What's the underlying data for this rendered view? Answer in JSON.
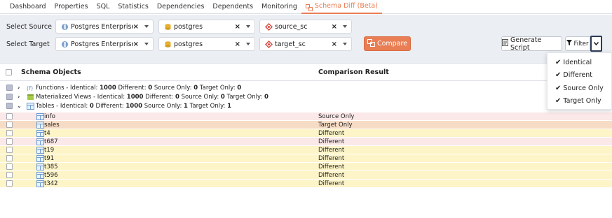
{
  "tabs": [
    {
      "label": "Dashboard"
    },
    {
      "label": "Properties"
    },
    {
      "label": "SQL"
    },
    {
      "label": "Statistics"
    },
    {
      "label": "Dependencies"
    },
    {
      "label": "Dependents"
    },
    {
      "label": "Monitoring"
    },
    {
      "label": "Schema Diff (Beta)",
      "active": true
    }
  ],
  "source": {
    "label": "Select Source",
    "server": "Postgres Enterprise ...",
    "database": "postgres",
    "schema": "source_sc"
  },
  "target": {
    "label": "Select Target",
    "server": "Postgres Enterprise ...",
    "database": "postgres",
    "schema": "target_sc"
  },
  "buttons": {
    "compare": "Compare",
    "generate_script": "Generate Script",
    "filter": "Filter"
  },
  "table": {
    "col_schema": "Schema Objects",
    "col_result": "Comparison Result"
  },
  "groups": [
    {
      "name": "Functions",
      "prefix": "Functions - Identical: ",
      "identical": "1000",
      "different_label": " Different: ",
      "different": "0",
      "source_label": " Source Only: ",
      "source_only": "0",
      "target_label": " Target Only: ",
      "target_only": "0",
      "expanded": false
    },
    {
      "name": "Materialized Views",
      "prefix": "Materialized Views - Identical: ",
      "identical": "1000",
      "different_label": " Different: ",
      "different": "0",
      "source_label": " Source Only: ",
      "source_only": "0",
      "target_label": " Target Only: ",
      "target_only": "0",
      "expanded": false
    },
    {
      "name": "Tables",
      "prefix": "Tables - Identical: ",
      "identical": "0",
      "different_label": " Different: ",
      "different": "1000",
      "source_label": " Source Only: ",
      "source_only": "1",
      "target_label": " Target Only: ",
      "target_only": "1",
      "expanded": true
    }
  ],
  "rows": [
    {
      "name": "info",
      "result": "Source Only",
      "status": "source"
    },
    {
      "name": "sales",
      "result": "Target Only",
      "status": "target"
    },
    {
      "name": "t4",
      "result": "Different",
      "status": "diff"
    },
    {
      "name": "t687",
      "result": "Different",
      "status": "diff-pink"
    },
    {
      "name": "t19",
      "result": "Different",
      "status": "diff"
    },
    {
      "name": "t91",
      "result": "Different",
      "status": "diff"
    },
    {
      "name": "t385",
      "result": "Different",
      "status": "diff"
    },
    {
      "name": "t596",
      "result": "Different",
      "status": "diff"
    },
    {
      "name": "t342",
      "result": "Different",
      "status": "diff"
    }
  ],
  "filter_menu": [
    {
      "label": "Identical",
      "checked": true
    },
    {
      "label": "Different",
      "checked": true
    },
    {
      "label": "Source Only",
      "checked": true
    },
    {
      "label": "Target Only",
      "checked": true
    }
  ],
  "colors": {
    "accent": "#e97e55",
    "source_only_bg": "#fbe8e8",
    "target_only_bg": "#f7dcc5",
    "different_bg": "#fdf4c8"
  },
  "icons": {
    "server": "server-icon",
    "database": "database-icon",
    "schema": "schema-icon",
    "compare": "compare-icon",
    "generate": "script-icon",
    "filter": "filter-icon",
    "table": "table-icon",
    "function": "function-icon",
    "matview": "materialized-view-icon",
    "check": "checkmark-icon"
  }
}
